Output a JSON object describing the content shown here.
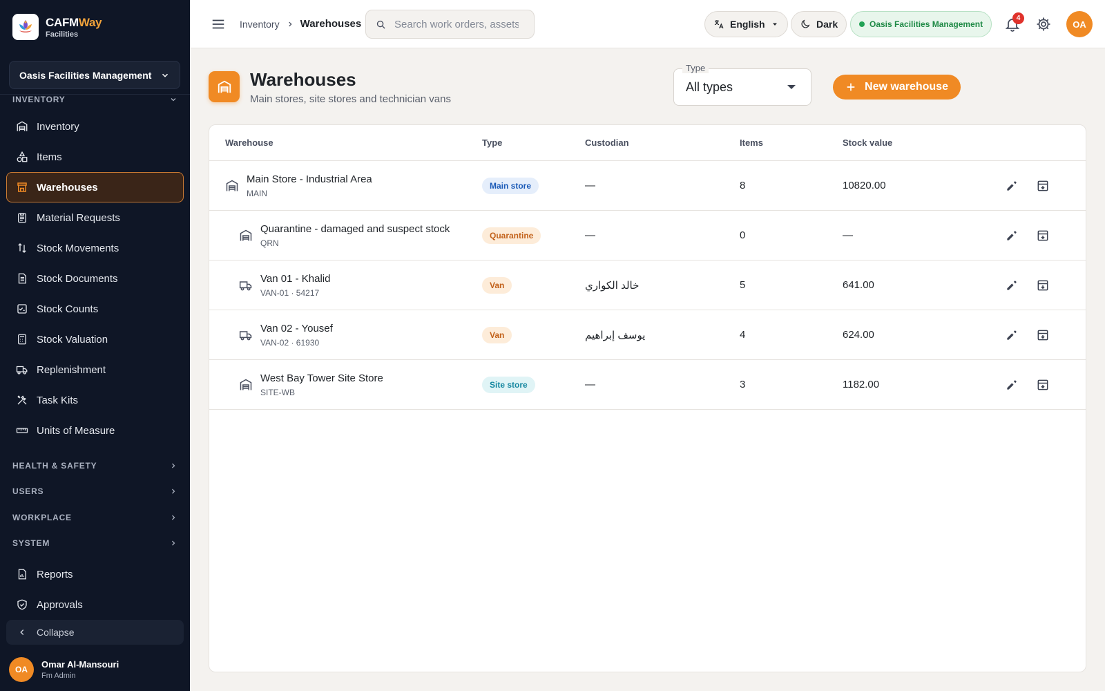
{
  "brand": {
    "name_main": "CAFM",
    "name_accent": "Way",
    "sub": "Facilities"
  },
  "org_selector": {
    "label": "Oasis Facilities Management"
  },
  "sidebar": {
    "section": "INVENTORY",
    "items": [
      {
        "label": "Inventory",
        "icon": "warehouse-icon"
      },
      {
        "label": "Items",
        "icon": "shapes-icon"
      },
      {
        "label": "Warehouses",
        "icon": "store-icon",
        "active": true
      },
      {
        "label": "Material Requests",
        "icon": "clipboard-icon"
      },
      {
        "label": "Stock Movements",
        "icon": "swap-vertical-icon"
      },
      {
        "label": "Stock Documents",
        "icon": "document-icon"
      },
      {
        "label": "Stock Counts",
        "icon": "checklist-icon"
      },
      {
        "label": "Stock Valuation",
        "icon": "calculator-icon"
      },
      {
        "label": "Replenishment",
        "icon": "truck-icon"
      },
      {
        "label": "Task Kits",
        "icon": "tools-icon"
      },
      {
        "label": "Units of Measure",
        "icon": "ruler-icon"
      }
    ],
    "collapsed_sections": [
      "HEALTH & SAFETY",
      "USERS",
      "WORKPLACE",
      "SYSTEM"
    ],
    "bottom_items": [
      {
        "label": "Reports",
        "icon": "report-icon"
      },
      {
        "label": "Approvals",
        "icon": "shield-check-icon"
      }
    ],
    "collapse_label": "Collapse"
  },
  "user": {
    "initials": "OA",
    "name": "Omar Al-Mansouri",
    "role": "Fm Admin"
  },
  "topbar": {
    "breadcrumb": [
      "Inventory",
      "Warehouses"
    ],
    "search_placeholder": "Search work orders, assets…",
    "language": "English",
    "theme": "Dark",
    "org_status": "Oasis Facilities Management",
    "notification_count": "4",
    "avatar_initials": "OA"
  },
  "page": {
    "title": "Warehouses",
    "subtitle": "Main stores, site stores and technician vans",
    "type_filter": {
      "label": "Type",
      "value": "All types"
    },
    "new_button": "New warehouse"
  },
  "table": {
    "columns": [
      "Warehouse",
      "Type",
      "Custodian",
      "Items",
      "Stock value"
    ],
    "rows": [
      {
        "name": "Main Store - Industrial Area",
        "code": "MAIN",
        "type": "Main store",
        "type_kind": "main",
        "icon": "warehouse-icon",
        "indent": false,
        "custodian": "—",
        "items": "8",
        "value": "10820.00"
      },
      {
        "name": "Quarantine - damaged and suspect stock",
        "code": "QRN",
        "type": "Quarantine",
        "type_kind": "quar",
        "icon": "warehouse-icon",
        "indent": true,
        "custodian": "—",
        "items": "0",
        "value": "—"
      },
      {
        "name": "Van 01 - Khalid",
        "code": "VAN-01 · 54217",
        "type": "Van",
        "type_kind": "van",
        "icon": "truck-icon",
        "indent": true,
        "custodian": "خالد الكواري",
        "items": "5",
        "value": "641.00"
      },
      {
        "name": "Van 02 - Yousef",
        "code": "VAN-02 · 61930",
        "type": "Van",
        "type_kind": "van",
        "icon": "truck-icon",
        "indent": true,
        "custodian": "يوسف إبراهيم",
        "items": "4",
        "value": "624.00"
      },
      {
        "name": "West Bay Tower Site Store",
        "code": "SITE-WB",
        "type": "Site store",
        "type_kind": "site",
        "icon": "warehouse-icon",
        "indent": true,
        "custodian": "—",
        "items": "3",
        "value": "1182.00"
      }
    ]
  },
  "colors": {
    "accent": "#f08a24",
    "sidebar_bg": "#0f1626",
    "status_green": "#22a356",
    "badge_red": "#e0322b"
  }
}
